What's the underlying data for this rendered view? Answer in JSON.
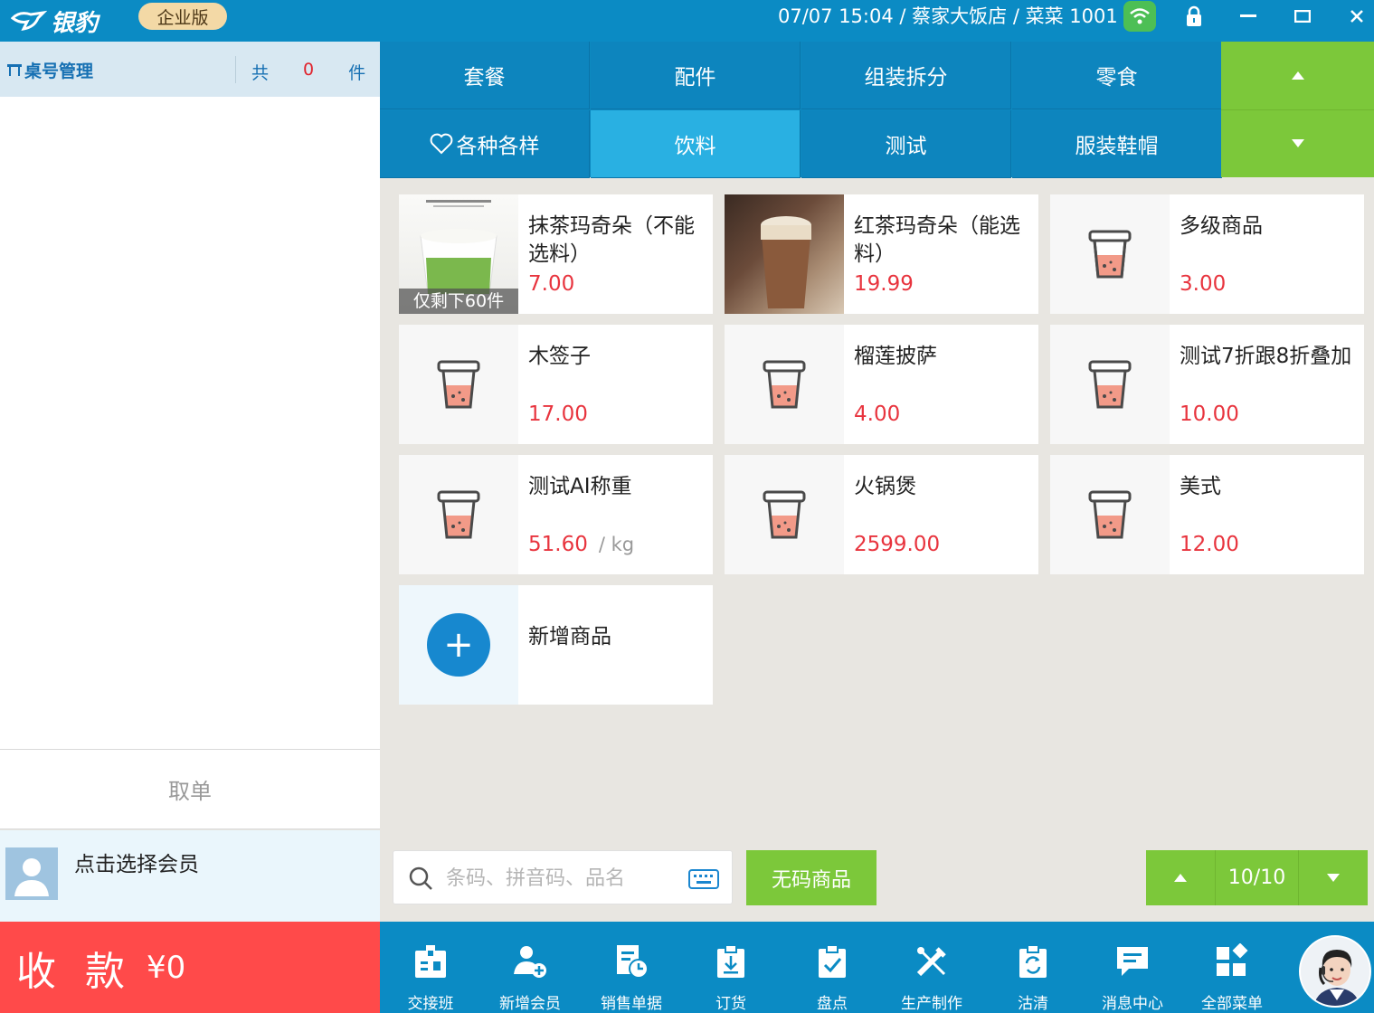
{
  "titlebar": {
    "logo_text": "银豹",
    "edition": "企业版",
    "info": "07/07 15:04 / 蔡家大饭店 / 菜菜 1001",
    "lock_glyph": "🔒",
    "minimize_glyph": "—",
    "maximize_glyph": "▭",
    "close_glyph": "✕"
  },
  "left": {
    "table_mgmt": "桌号管理",
    "count_prefix": "共",
    "count_value": "0",
    "count_suffix": "件",
    "cancel": "取单",
    "member_prompt": "点击选择会员",
    "checkout_label": "收款",
    "checkout_amount": "¥0"
  },
  "categories": [
    {
      "label": "套餐",
      "icon": ""
    },
    {
      "label": "配件",
      "icon": ""
    },
    {
      "label": "组装拆分",
      "icon": ""
    },
    {
      "label": "零食",
      "icon": ""
    },
    {
      "label": "各种各样",
      "icon": "heart-icon"
    },
    {
      "label": "饮料",
      "icon": "",
      "active": true
    },
    {
      "label": "测试",
      "icon": ""
    },
    {
      "label": "服装鞋帽",
      "icon": ""
    }
  ],
  "products": [
    {
      "name": "抹茶玛奇朵（不能选料）",
      "price": "7.00",
      "stock_note": "仅剩下60件",
      "thumb": "photo-matcha"
    },
    {
      "name": "红茶玛奇朵（能选料）",
      "price": "19.99",
      "thumb": "photo-blacktea"
    },
    {
      "name": "多级商品",
      "price": "3.00",
      "thumb": "cup-icon"
    },
    {
      "name": "木签子",
      "price": "17.00",
      "thumb": "cup-icon"
    },
    {
      "name": "榴莲披萨",
      "price": "4.00",
      "thumb": "cup-icon"
    },
    {
      "name": "测试7折跟8折叠加",
      "price": "10.00",
      "thumb": "cup-icon"
    },
    {
      "name": "测试AI称重",
      "price": "51.60",
      "unit": "/ kg",
      "thumb": "cup-icon"
    },
    {
      "name": "火锅煲",
      "price": "2599.00",
      "thumb": "cup-icon"
    },
    {
      "name": "美式",
      "price": "12.00",
      "thumb": "cup-icon"
    }
  ],
  "add_product": {
    "label": "新增商品",
    "glyph": "+"
  },
  "search": {
    "placeholder": "条码、拼音码、品名"
  },
  "nocode_button": "无码商品",
  "pager": {
    "text": "10/10"
  },
  "toolbar": [
    {
      "label": "交接班",
      "icon": "handover-icon"
    },
    {
      "label": "新增会员",
      "icon": "add-member-icon"
    },
    {
      "label": "销售单据",
      "icon": "sales-doc-icon"
    },
    {
      "label": "订货",
      "icon": "order-icon"
    },
    {
      "label": "盘点",
      "icon": "inventory-icon"
    },
    {
      "label": "生产制作",
      "icon": "production-icon"
    },
    {
      "label": "沽清",
      "icon": "soldout-icon"
    },
    {
      "label": "消息中心",
      "icon": "message-icon"
    },
    {
      "label": "全部菜单",
      "icon": "all-menu-icon"
    }
  ],
  "colors": {
    "brand_blue": "#0b8bc4",
    "active_tab": "#29b0e2",
    "green": "#7cc83a",
    "price_red": "#e8343e",
    "checkout_red": "#ff4a4a"
  }
}
